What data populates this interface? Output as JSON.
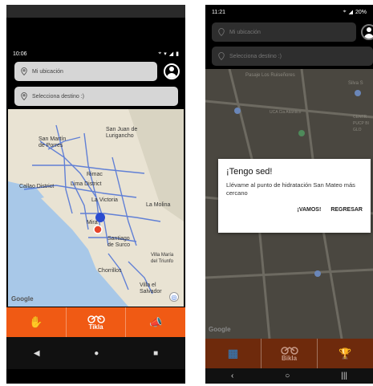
{
  "left_screen": {
    "status": {
      "time": "10:06"
    },
    "origin_placeholder": "Mi ubicación",
    "destination_placeholder": "Selecciona destino :)",
    "map_labels": {
      "san_martin": "San Martín\nde Porres",
      "sjl": "San Juan de\nLurigancho",
      "rimac": "Rimac",
      "callao": "Callao District",
      "lima": "Lima District",
      "la_victoria": "La Victoria",
      "la_molina": "La Molina",
      "santiago": "Santiago\nde Surco",
      "villa_maria": "Villa María\ndel Triunfo",
      "chorrillos": "Chorrillos",
      "villa_salvador": "Villa el\nSalvador",
      "mira": "Mira"
    },
    "google": "Google",
    "nav": {
      "center_label": "Tikla"
    },
    "accent": "#f05a14"
  },
  "right_screen": {
    "status": {
      "time": "11:21",
      "battery": "20%"
    },
    "origin_placeholder": "Mi ubicación",
    "destination_placeholder": "Selecciona destino :)",
    "map_labels": {
      "top": "Pasaje Los Ruiseñores",
      "silva": "Silva S",
      "centro": "CENTR\nPUCP BI\nGLO",
      "cia": "UCA Cia Atlántico"
    },
    "dialog": {
      "title": "¡Tengo sed!",
      "message": "Llévame al punto de hidratación San Mateo más cercano",
      "confirm": "¡VAMOS!",
      "cancel": "REGRESAR"
    },
    "google": "Google",
    "nav": {
      "center_label": "Bikla"
    },
    "accent": "#b5420f"
  }
}
